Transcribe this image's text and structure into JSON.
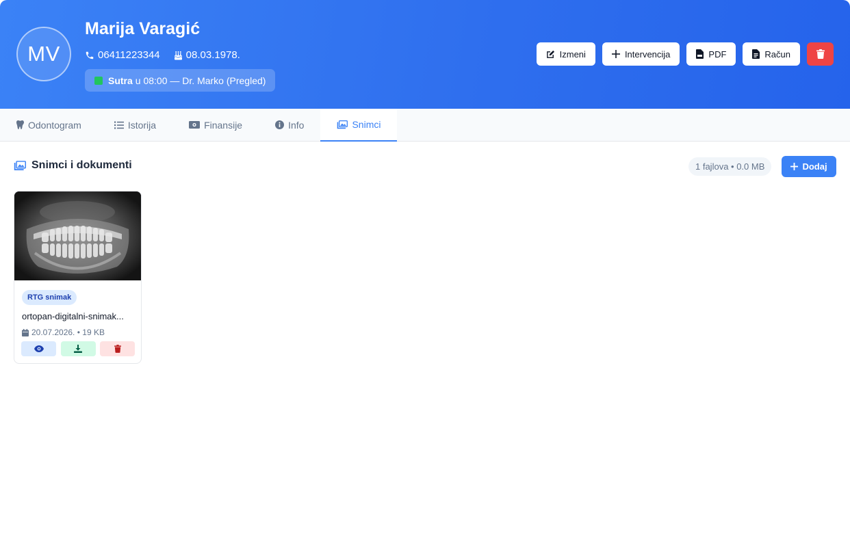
{
  "patient": {
    "initials": "MV",
    "name": "Marija Varagić",
    "phone": "06411223344",
    "birth_date": "08.03.1978.",
    "appointment": {
      "day": "Sutra",
      "details": "u 08:00 — Dr. Marko (Pregled)"
    }
  },
  "header_actions": {
    "edit_label": "Izmeni",
    "intervention_label": "Intervencija",
    "pdf_label": "PDF",
    "invoice_label": "Račun"
  },
  "tabs": [
    {
      "label": "Odontogram",
      "icon": "tooth-icon"
    },
    {
      "label": "Istorija",
      "icon": "list-icon"
    },
    {
      "label": "Finansije",
      "icon": "money-icon"
    },
    {
      "label": "Info",
      "icon": "info-icon"
    },
    {
      "label": "Snimci",
      "icon": "images-icon",
      "active": true
    }
  ],
  "section": {
    "title": "Snimci i dokumenti",
    "stats": "1 fajlova • 0.0 MB",
    "add_label": "Dodaj"
  },
  "files": [
    {
      "tag": "RTG snimak",
      "name": "ortopan-digitalni-snimak...",
      "date": "20.07.2026.",
      "size": "19 KB"
    }
  ],
  "colors": {
    "primary": "#3b82f6",
    "header_gradient_end": "#2563eb",
    "danger": "#ef4444",
    "appointment_dot": "#22c55e"
  }
}
